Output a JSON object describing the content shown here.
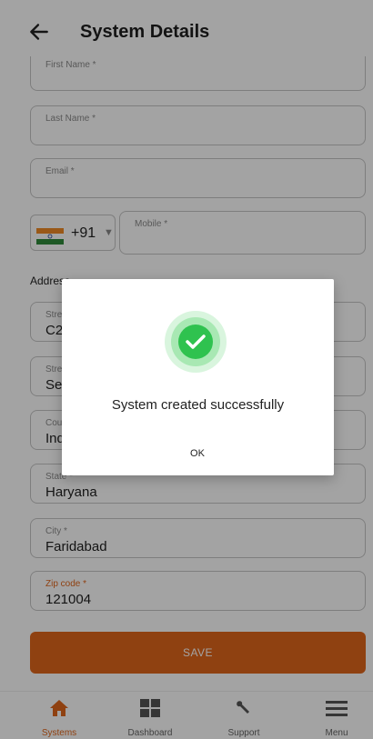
{
  "header": {
    "title": "System Details"
  },
  "form": {
    "first_name_label": "First Name *",
    "last_name_label": "Last Name *",
    "email_label": "Email *",
    "country_code": "+91",
    "mobile_label": "Mobile *",
    "address_section": "Address",
    "street1_label": "Street 1 *",
    "street1_value": "C2",
    "street2_label": "Street 2",
    "street2_value": "Se",
    "country_label": "Country *",
    "country_value": "Ind",
    "state_label": "State *",
    "state_value": "Haryana",
    "city_label": "City *",
    "city_value": "Faridabad",
    "zip_label": "Zip code *",
    "zip_value": "121004",
    "save_label": "SAVE"
  },
  "nav": {
    "items": [
      {
        "label": "Systems",
        "icon": "home-icon",
        "active": true
      },
      {
        "label": "Dashboard",
        "icon": "dashboard-icon",
        "active": false
      },
      {
        "label": "Support",
        "icon": "wrench-icon",
        "active": false
      },
      {
        "label": "Menu",
        "icon": "menu-icon",
        "active": false
      }
    ]
  },
  "dialog": {
    "message": "System created successfully",
    "ok_label": "OK",
    "icon": "success-check-icon"
  },
  "colors": {
    "accent": "#e0661c",
    "success": "#2fc24f"
  }
}
